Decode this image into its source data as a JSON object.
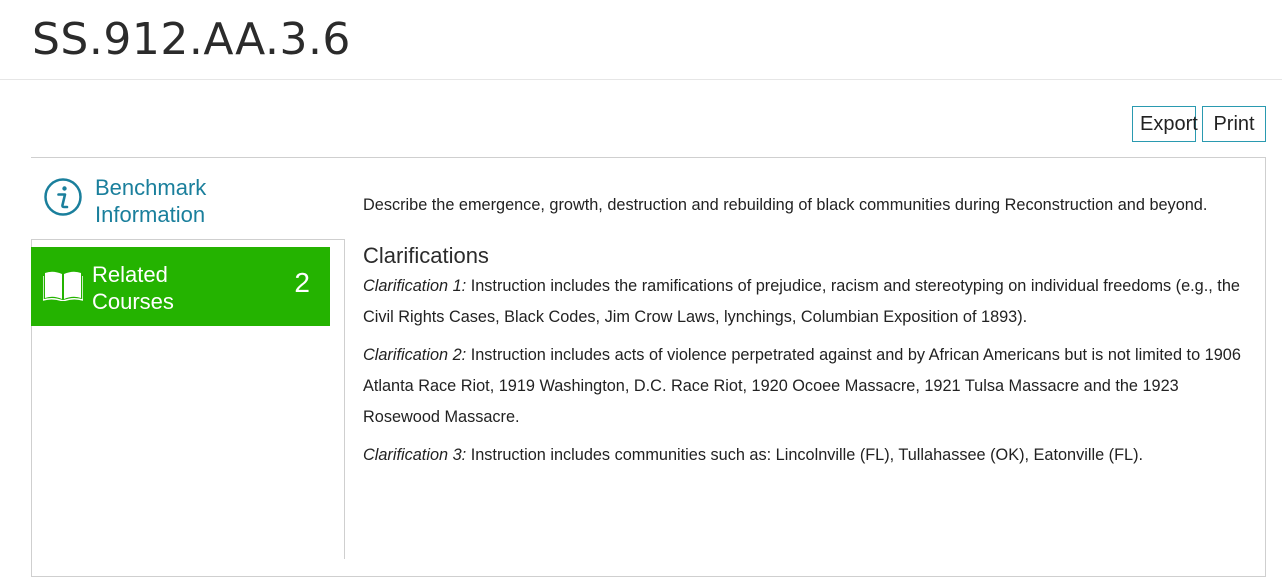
{
  "page": {
    "title": "SS.912.AA.3.6"
  },
  "toolbar": {
    "export_label": "Export",
    "print_label": "Print"
  },
  "tabs": {
    "benchmark": {
      "label_line1": "Benchmark",
      "label_line2": "Information",
      "icon": "info-circle-icon"
    },
    "courses": {
      "label_line1": "Related",
      "label_line2": "Courses",
      "count": "2",
      "icon": "open-book-icon"
    }
  },
  "content": {
    "description": "Describe the emergence, growth, destruction and rebuilding of black communities during Reconstruction and beyond.",
    "clarifications_heading": "Clarifications",
    "clarifications": [
      {
        "label": "Clarification 1:",
        "text": " Instruction includes the ramifications of prejudice, racism and stereotyping on individual freedoms (e.g., the Civil Rights Cases, Black Codes, Jim Crow Laws, lynchings, Columbian Exposition of 1893)."
      },
      {
        "label": "Clarification 2:",
        "text": " Instruction includes acts of violence perpetrated against and by African Americans but is not limited to 1906 Atlanta Race Riot, 1919 Washington, D.C. Race Riot, 1920 Ocoee Massacre, 1921 Tulsa Massacre and the 1923 Rosewood Massacre."
      },
      {
        "label": "Clarification 3:",
        "text": " Instruction includes communities such as: Lincolnville (FL), Tullahassee (OK), Eatonville (FL)."
      }
    ]
  },
  "colors": {
    "accent": "#1a7f9c",
    "active_tab": "#24b300",
    "button_border": "#2a9ab0"
  }
}
